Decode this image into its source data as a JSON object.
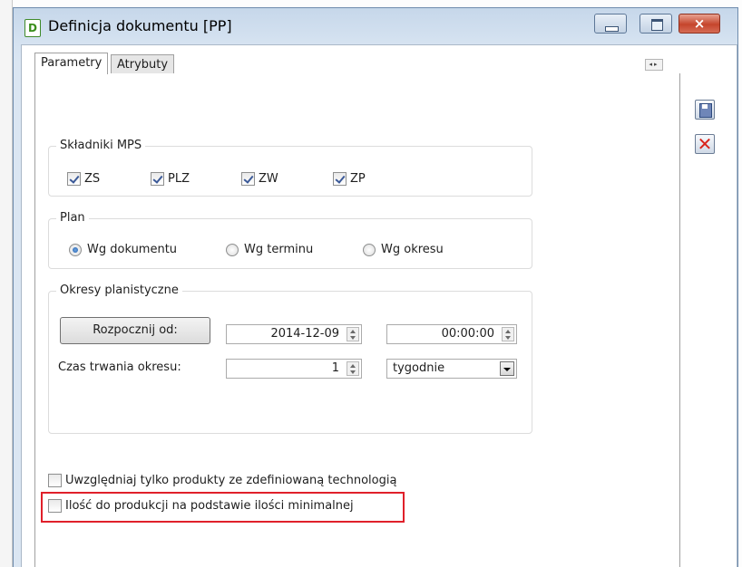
{
  "window": {
    "icon_letter": "D",
    "title": "Definicja dokumentu [PP]",
    "close_glyph": "×"
  },
  "tabs": [
    {
      "label": "Parametry",
      "active": true
    },
    {
      "label": "Atrybuty",
      "active": false
    }
  ],
  "mps": {
    "title": "Składniki MPS",
    "items": [
      {
        "label": "ZS",
        "checked": true
      },
      {
        "label": "PLZ",
        "checked": true
      },
      {
        "label": "ZW",
        "checked": true
      },
      {
        "label": "ZP",
        "checked": true
      }
    ]
  },
  "plan": {
    "title": "Plan",
    "options": [
      {
        "label": "Wg dokumentu",
        "selected": true
      },
      {
        "label": "Wg terminu",
        "selected": false
      },
      {
        "label": "Wg okresu",
        "selected": false
      }
    ]
  },
  "okresy": {
    "title": "Okresy planistyczne",
    "start_button": "Rozpocznij od:",
    "start_date": "2014-12-09",
    "start_time": "00:00:00",
    "duration_label": "Czas trwania okresu:",
    "duration_value": "1",
    "duration_unit": "tygodnie"
  },
  "options": {
    "only_with_technology": {
      "label": "Uwzględniaj tylko produkty ze zdefiniowaną technologią",
      "checked": false
    },
    "min_quantity": {
      "label": "Ilość do produkcji na podstawie ilości minimalnej",
      "checked": false
    }
  },
  "colors": {
    "highlight": "#e0202a",
    "title_bar": "#c6d7ea",
    "close_button": "#c5452c"
  },
  "icons": {
    "save": "save-icon",
    "cancel": "cancel-icon"
  }
}
